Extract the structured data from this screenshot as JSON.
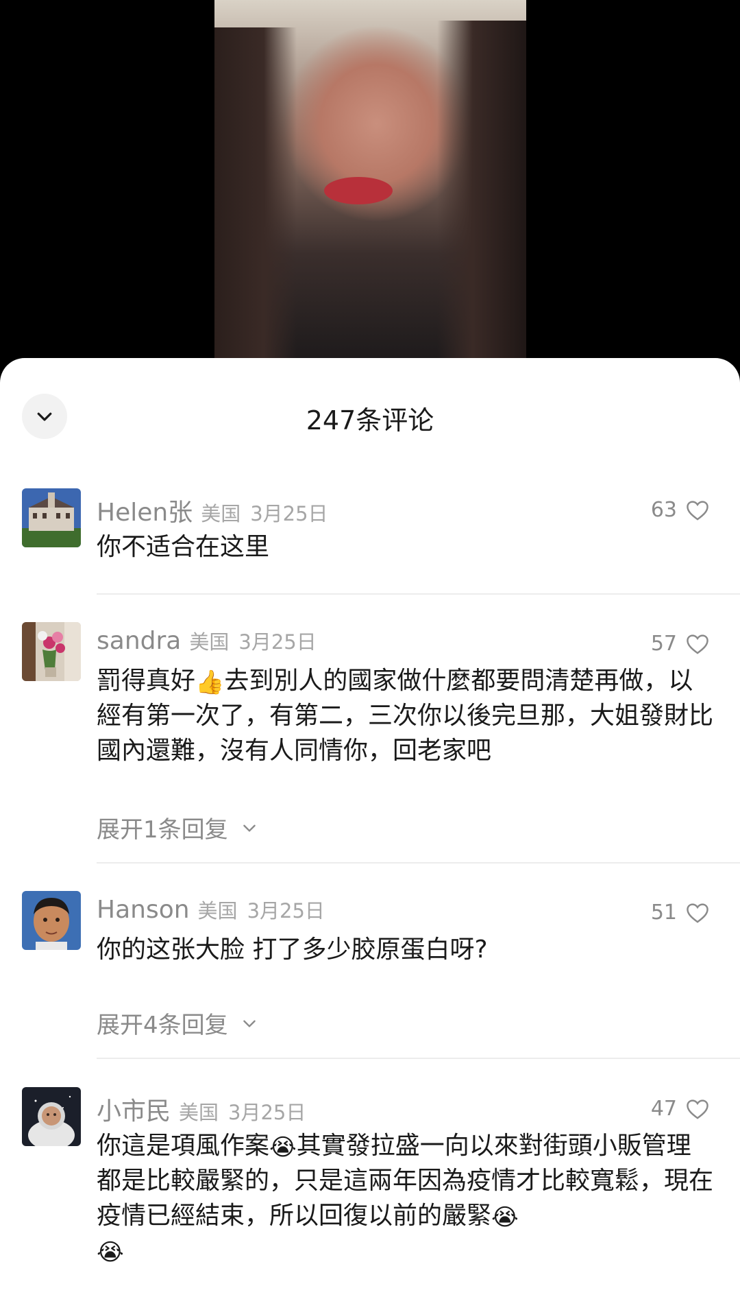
{
  "sheet": {
    "title": "247条评论"
  },
  "comments": [
    {
      "name": "Helen张",
      "region": "美国",
      "date": "3月25日",
      "likes": "63",
      "text": "你不适合在这里",
      "avatar_icon": "building-avatar"
    },
    {
      "name": "sandra",
      "region": "美国",
      "date": "3月25日",
      "likes": "57",
      "text_before": "罰得真好",
      "emoji": "👍",
      "text_after": "去到別人的國家做什麼都要問清楚再做，以經有第一次了，有第二，三次你以後完旦那，大姐發財比國內還難，沒有人同情你，回老家吧",
      "replies_label": "展开1条回复",
      "avatar_icon": "flowers-avatar"
    },
    {
      "name": "Hanson",
      "region": "美国",
      "date": "3月25日",
      "likes": "51",
      "text": "你的这张大脸 打了多少胶原蛋白呀?",
      "replies_label": "展开4条回复",
      "avatar_icon": "boy-avatar"
    },
    {
      "name": "小市民",
      "region": "美国",
      "date": "3月25日",
      "likes": "47",
      "text_part1": "你這是項風作案",
      "emoji": "😭",
      "text_part2": "其實發拉盛一向以來對街頭小販管理都是比較嚴緊的，只是這兩年因為疫情才比較寬鬆，現在疫情已經結束，所以回復以前的嚴緊",
      "avatar_icon": "astronaut-avatar"
    }
  ],
  "colors": {
    "accent_text": "#1a1a1a",
    "meta": "#a6a6a6",
    "sheet_bg": "#ffffff"
  }
}
